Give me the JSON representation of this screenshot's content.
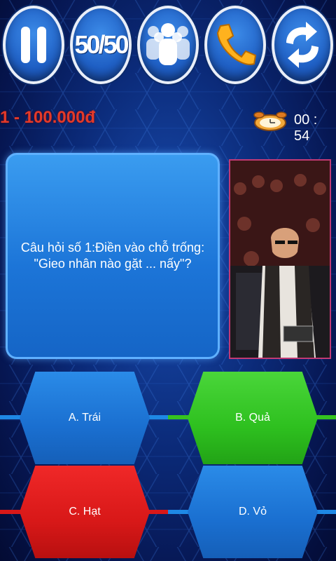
{
  "lifelines": [
    {
      "name": "pause",
      "icon": "pause-icon"
    },
    {
      "name": "fifty_fifty",
      "label": "50/50",
      "icon": "fifty-fifty-icon"
    },
    {
      "name": "ask_audience",
      "icon": "audience-icon"
    },
    {
      "name": "phone_friend",
      "icon": "phone-icon"
    },
    {
      "name": "switch_question",
      "icon": "switch-icon"
    }
  ],
  "status": {
    "prize": "1 - 100.000đ",
    "timer": "00 : 54"
  },
  "question": {
    "text": "Câu hỏi số 1:Điền vào chỗ trống: \"Gieo nhân nào gặt ... nấy\"?"
  },
  "answers": [
    {
      "label": "A. Trái",
      "state": "normal",
      "color": "#1a6fd0"
    },
    {
      "label": "B. Quả",
      "state": "selected-correct",
      "color": "#2ec01f"
    },
    {
      "label": "C. Hạt",
      "state": "wrong",
      "color": "#d81818"
    },
    {
      "label": "D. Vỏ",
      "state": "normal",
      "color": "#1a6fd0"
    }
  ],
  "colors": {
    "prize": "#e33a2a",
    "line_blue": "#1e88e5",
    "line_green": "#35c21f",
    "line_red": "#d81818"
  }
}
